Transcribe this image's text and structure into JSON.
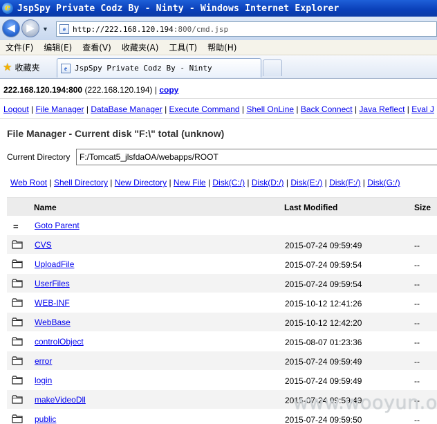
{
  "window": {
    "title": "JspSpy Private Codz By - Ninty - Windows Internet Explorer"
  },
  "address": {
    "url_host": "http://222.168.120.194",
    "url_rest": ":800/cmd.jsp"
  },
  "menubar": {
    "items": [
      "文件(F)",
      "编辑(E)",
      "查看(V)",
      "收藏夹(A)",
      "工具(T)",
      "帮助(H)"
    ]
  },
  "favbar": {
    "favorites_label": "收藏夹",
    "tab_title": "JspSpy Private Codz By - Ninty"
  },
  "header": {
    "host": "222.168.120.194:800",
    "host_paren": " (222.168.120.194) ",
    "sep": "|",
    "copy_label": "copy"
  },
  "nav": {
    "links": [
      "Logout",
      "File Manager",
      "DataBase Manager",
      "Execute Command",
      "Shell OnLine",
      "Back Connect",
      "Java Reflect",
      "Eval J"
    ]
  },
  "filemanager": {
    "title": "File Manager - Current disk \"F:\\\" total (unknow)",
    "current_dir_label": "Current Directory",
    "current_dir_value": "F:/Tomcat5_jlsfdaOA/webapps/ROOT",
    "disk_links": [
      "Web Root",
      "Shell Directory",
      "New Directory",
      "New File",
      "Disk(C:/)",
      "Disk(D:/)",
      "Disk(E:/)",
      "Disk(F:/)",
      "Disk(G:/)"
    ],
    "columns": {
      "name": "Name",
      "modified": "Last Modified",
      "size": "Size"
    },
    "parent_icon": "=",
    "parent_label": "Goto Parent",
    "rows": [
      {
        "name": "CVS",
        "modified": "2015-07-24 09:59:49",
        "size": "--"
      },
      {
        "name": "UploadFile",
        "modified": "2015-07-24 09:59:54",
        "size": "--"
      },
      {
        "name": "UserFiles",
        "modified": "2015-07-24 09:59:54",
        "size": "--"
      },
      {
        "name": "WEB-INF",
        "modified": "2015-10-12 12:41:26",
        "size": "--"
      },
      {
        "name": "WebBase",
        "modified": "2015-10-12 12:42:20",
        "size": "--"
      },
      {
        "name": "controlObject",
        "modified": "2015-08-07 01:23:36",
        "size": "--"
      },
      {
        "name": "error",
        "modified": "2015-07-24 09:59:49",
        "size": "--"
      },
      {
        "name": "login",
        "modified": "2015-07-24 09:59:49",
        "size": "--"
      },
      {
        "name": "makeVideoDll",
        "modified": "2015-07-24 09:59:49",
        "size": "--"
      },
      {
        "name": "public",
        "modified": "2015-07-24 09:59:50",
        "size": "--"
      }
    ]
  },
  "watermark": "www.wooyun.org"
}
